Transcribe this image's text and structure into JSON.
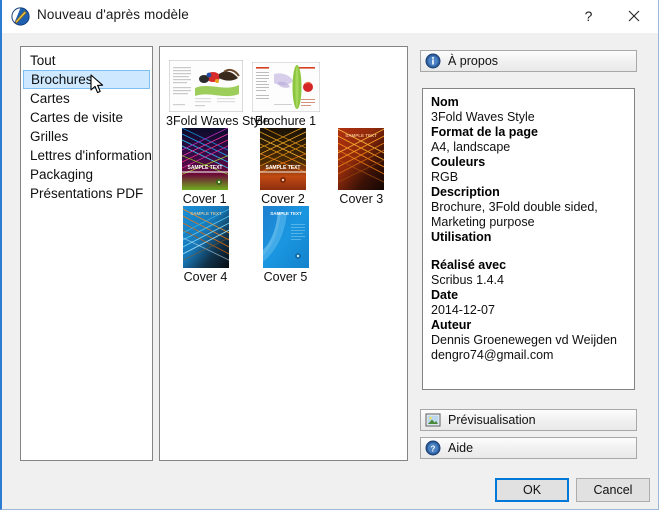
{
  "window": {
    "title": "Nouveau d'après modèle",
    "app_icon": "scribus-icon",
    "help_button": "?",
    "close_button": "close-icon"
  },
  "categories": {
    "items": [
      {
        "label": "Tout",
        "selected": false
      },
      {
        "label": "Brochures",
        "selected": true
      },
      {
        "label": "Cartes",
        "selected": false
      },
      {
        "label": "Cartes de visite",
        "selected": false
      },
      {
        "label": "Grilles",
        "selected": false
      },
      {
        "label": "Lettres d'information",
        "selected": false
      },
      {
        "label": "Packaging",
        "selected": false
      },
      {
        "label": "Présentations PDF",
        "selected": false
      }
    ]
  },
  "templates": {
    "items": [
      {
        "label": "3Fold Waves Style",
        "thumb": "brochure-3fold-waves-thumb"
      },
      {
        "label": "Brochure 1",
        "thumb": "brochure-1-thumb"
      },
      {
        "label": "Cover 1",
        "thumb": "cover-1-thumb"
      },
      {
        "label": "Cover 2",
        "thumb": "cover-2-thumb"
      },
      {
        "label": "Cover 3",
        "thumb": "cover-3-thumb"
      },
      {
        "label": "Cover 4",
        "thumb": "cover-4-thumb"
      },
      {
        "label": "Cover 5",
        "thumb": "cover-5-thumb"
      }
    ],
    "sample_text": "SAMPLE TEXT"
  },
  "about": {
    "header": "À propos",
    "header_icon": "info-icon",
    "fields": [
      {
        "label": "Nom",
        "value": "3Fold Waves Style"
      },
      {
        "label": "Format de la page",
        "value": "A4, landscape"
      },
      {
        "label": "Couleurs",
        "value": "RGB"
      },
      {
        "label": "Description",
        "value": "Brochure, 3Fold double sided, Marketing purpose"
      },
      {
        "label": "Utilisation",
        "value": ""
      }
    ],
    "fields2": [
      {
        "label": "Réalisé avec",
        "value": "Scribus 1.4.4"
      },
      {
        "label": "Date",
        "value": "2014-12-07"
      },
      {
        "label": "Auteur",
        "value": "Dennis Groenewegen vd Weijden"
      }
    ],
    "author_email": "dengro74@gmail.com"
  },
  "side_buttons": {
    "preview": {
      "label": "Prévisualisation",
      "icon": "image-icon"
    },
    "help": {
      "label": "Aide",
      "icon": "question-icon"
    }
  },
  "dialog_buttons": {
    "ok": "OK",
    "cancel": "Cancel"
  },
  "colors": {
    "accent": "#0078d7",
    "selection": "#cde8ff",
    "window_bg": "#f0f0f0",
    "panel_bg": "#ffffff",
    "border": "#848484"
  }
}
